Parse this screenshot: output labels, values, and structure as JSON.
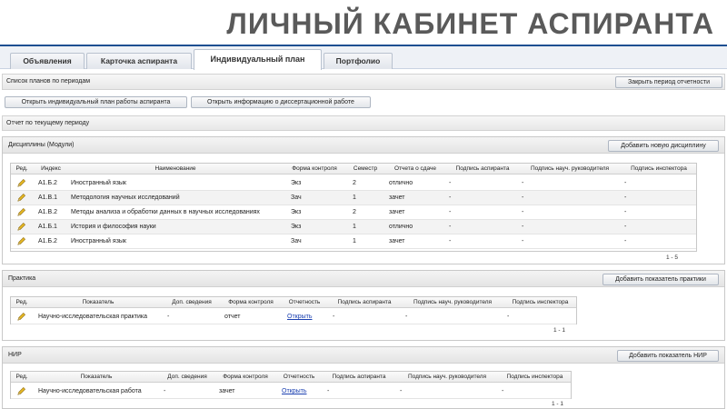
{
  "slide_title": "ЛИЧНЫЙ КАБИНЕТ АСПИРАНТА",
  "tabs": [
    "Объявления",
    "Карточка аспиранта",
    "Индивидуальный план",
    "Портфолио"
  ],
  "active_tab": "Индивидуальный план",
  "plans": {
    "label": "Список планов по периодам",
    "close_period_button": "Закрыть период отчетности",
    "open_plan_button": "Открыть индивидуальный план работы аспиранта",
    "open_dissertation_button": "Открыть информацию о диссертационной работе"
  },
  "report_label": "Отчет по текущему периоду",
  "disciplines": {
    "title": "Дисциплины (Модули)",
    "add_button": "Добавить новую дисциплину",
    "columns": [
      "Ред.",
      "Индекс",
      "Наименование",
      "Форма контроля",
      "Семестр",
      "Отчета о сдаче",
      "Подпись аспиранта",
      "Подпись науч. руководителя",
      "Подпись инспектора"
    ],
    "rows": [
      {
        "index": "А1.Б.2",
        "name": "Иностранный язык",
        "control": "Экз",
        "semester": "2",
        "result": "отлично",
        "sig_asp": "-",
        "sig_sup": "-",
        "sig_insp": "-"
      },
      {
        "index": "А1.В.1",
        "name": "Методология научных исследований",
        "control": "Зач",
        "semester": "1",
        "result": "зачет",
        "sig_asp": "-",
        "sig_sup": "-",
        "sig_insp": "-"
      },
      {
        "index": "А1.В.2",
        "name": "Методы анализа и обработки данных в научных исследованиях",
        "control": "Экз",
        "semester": "2",
        "result": "зачет",
        "sig_asp": "-",
        "sig_sup": "-",
        "sig_insp": "-"
      },
      {
        "index": "А1.Б.1",
        "name": "История и философия науки",
        "control": "Экз",
        "semester": "1",
        "result": "отлично",
        "sig_asp": "-",
        "sig_sup": "-",
        "sig_insp": "-"
      },
      {
        "index": "А1.Б.2",
        "name": "Иностранный язык",
        "control": "Зач",
        "semester": "1",
        "result": "зачет",
        "sig_asp": "-",
        "sig_sup": "-",
        "sig_insp": "-"
      }
    ],
    "pager": "1 - 5"
  },
  "practice": {
    "title": "Практика",
    "add_button": "Добавить показатель практики",
    "columns": [
      "Ред.",
      "Показатель",
      "Доп. сведения",
      "Форма контроля",
      "Отчетность",
      "Подпись аспиранта",
      "Подпись науч. руководителя",
      "Подпись инспектора"
    ],
    "rows": [
      {
        "indicator": "Научно-исследовательская практика",
        "extra": "-",
        "control": "отчет",
        "report": "Открыть",
        "sig_asp": "-",
        "sig_sup": "-",
        "sig_insp": "-"
      }
    ],
    "pager": "1 - 1"
  },
  "nir": {
    "title": "НИР",
    "add_button": "Добавить показатель НИР",
    "columns": [
      "Ред.",
      "Показатель",
      "Доп. сведения",
      "Форма контроля",
      "Отчетность",
      "Подпись аспиранта",
      "Подпись науч. руководителя",
      "Подпись инспектора"
    ],
    "rows": [
      {
        "indicator": "Научно-исследовательская работа",
        "extra": "-",
        "control": "зачет",
        "report": "Открыть",
        "sig_asp": "-",
        "sig_sup": "-",
        "sig_insp": "-"
      }
    ],
    "pager": "1 - 1"
  },
  "colors": {
    "accent": "#1d4f91",
    "pencil": "#e0b21a",
    "link": "#1a3fb0"
  },
  "icons": {
    "edit": "pencil-icon"
  }
}
